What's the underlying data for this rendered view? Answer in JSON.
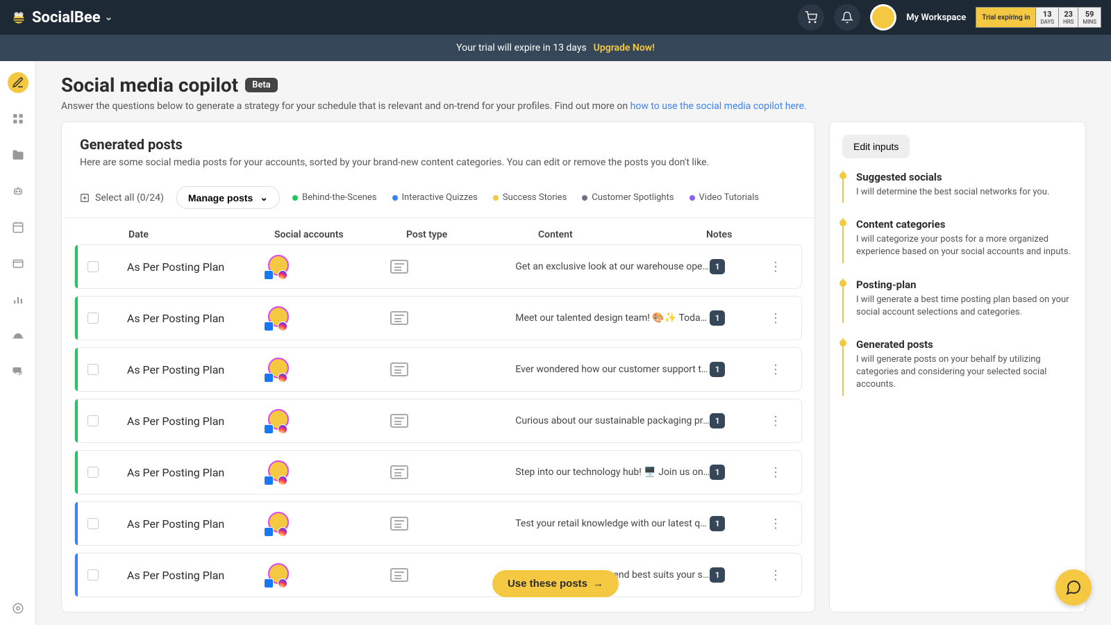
{
  "brand": "SocialBee",
  "workspace": "My Workspace",
  "trial_banner": {
    "text": "Your trial will expire in 13 days",
    "cta": "Upgrade Now!"
  },
  "trial_box": {
    "label": "Trial expiring in",
    "days": "13",
    "hrs": "23",
    "mins": "59",
    "days_label": "DAYS",
    "hrs_label": "HRS",
    "mins_label": "MINS"
  },
  "page": {
    "title": "Social media copilot",
    "badge": "Beta",
    "desc_pre": "Answer the questions below to generate a strategy for your schedule that is relevant and on-trend for your profiles. Find out more on ",
    "desc_link": "how to use the social media copilot here."
  },
  "panel": {
    "title": "Generated posts",
    "sub": "Here are some social media posts for your accounts, sorted by your brand-new content categories. You can edit or remove the posts you don't like."
  },
  "toolbar": {
    "select_all": "Select all (0/24)",
    "manage": "Manage posts"
  },
  "legend": [
    {
      "label": "Behind-the-Scenes",
      "color": "#22c55e"
    },
    {
      "label": "Interactive Quizzes",
      "color": "#3b82f6"
    },
    {
      "label": "Success Stories",
      "color": "#f5c842"
    },
    {
      "label": "Customer Spotlights",
      "color": "#6b7280"
    },
    {
      "label": "Video Tutorials",
      "color": "#8b5cf6"
    }
  ],
  "columns": {
    "date": "Date",
    "social": "Social accounts",
    "posttype": "Post type",
    "content": "Content",
    "notes": "Notes"
  },
  "rows": [
    {
      "stripe": "#22c55e",
      "date": "As Per Posting Plan",
      "content": "Get an exclusive look at our warehouse operatio...",
      "notes": "1"
    },
    {
      "stripe": "#22c55e",
      "date": "As Per Posting Plan",
      "content": "Meet our talented design team! 🎨✨ Today, were...",
      "notes": "1"
    },
    {
      "stripe": "#22c55e",
      "date": "As Per Posting Plan",
      "content": "Ever wondered how our customer support team ...",
      "notes": "1"
    },
    {
      "stripe": "#22c55e",
      "date": "As Per Posting Plan",
      "content": "Curious about our sustainable packaging practic...",
      "notes": "1"
    },
    {
      "stripe": "#22c55e",
      "date": "As Per Posting Plan",
      "content": "Step into our technology hub! 🖥️ Join us on a vi...",
      "notes": "1"
    },
    {
      "stripe": "#3b82f6",
      "date": "As Per Posting Plan",
      "content": "Test your retail knowledge with our latest quiz! ...",
      "notes": "1"
    },
    {
      "stripe": "#3b82f6",
      "date": "As Per Posting Plan",
      "content": "Discover which retail trend best suits your style! ...",
      "notes": "1"
    }
  ],
  "side": {
    "edit": "Edit inputs",
    "steps": [
      {
        "title": "Suggested socials",
        "desc": "I will determine the best social networks for you."
      },
      {
        "title": "Content categories",
        "desc": "I will categorize your posts for a more organized experience based on your social accounts and inputs."
      },
      {
        "title": "Posting-plan",
        "desc": "I will generate a best time posting plan based on your social account selections and categories."
      },
      {
        "title": "Generated posts",
        "desc": "I will generate posts on your behalf by utilizing categories and considering your selected social accounts."
      }
    ]
  },
  "use_btn": "Use these posts"
}
